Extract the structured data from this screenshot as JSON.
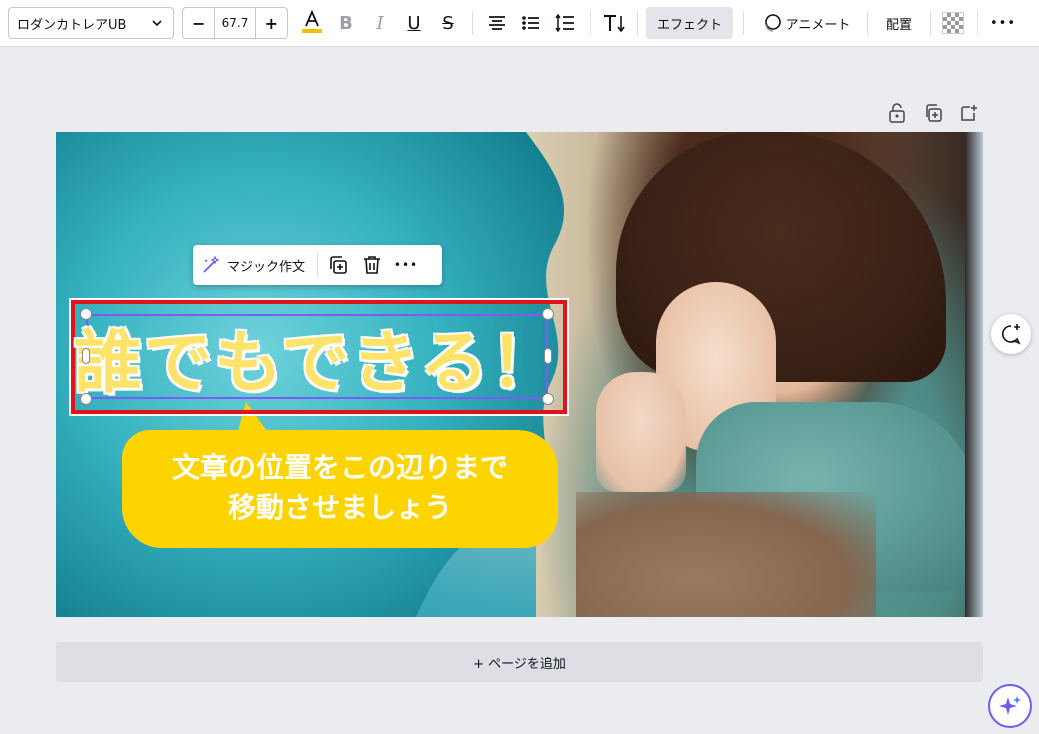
{
  "toolbar": {
    "font_name": "ロダンカトレアUB",
    "font_size": "67.7",
    "minus_label": "−",
    "plus_label": "+",
    "bold_label": "B",
    "italic_label": "I",
    "underline_label": "U",
    "strike_label": "S",
    "effect_label": "エフェクト",
    "animate_label": "アニメート",
    "arrange_label": "配置",
    "more_label": "•••",
    "text_color": "#f2c200",
    "icons": [
      "text-color-icon",
      "bold-icon",
      "italic-icon",
      "underline-icon",
      "strikethrough-icon",
      "align-center-icon",
      "list-icon",
      "line-spacing-icon",
      "text-direction-icon",
      "animate-icon",
      "transparency-icon",
      "more-icon"
    ]
  },
  "page_controls": {
    "icons": [
      "lock-icon",
      "duplicate-page-icon",
      "add-page-icon"
    ]
  },
  "context_bar": {
    "magic_write_label": "マジック作文",
    "more_label": "•••",
    "icons": [
      "magic-wand-icon",
      "duplicate-icon",
      "trash-icon",
      "more-icon"
    ]
  },
  "canvas": {
    "headline": "誰でもできる！",
    "bubble_line1": "文章の位置をこの辺りまで",
    "bubble_line2": "移動させましょう",
    "bubble_color": "#fdd400",
    "highlight_color": "#e0131a",
    "selection_color": "#7b5cf5"
  },
  "add_page": {
    "label": "+ ページを追加"
  },
  "floating": {
    "icons": [
      "comment-add-icon",
      "magic-sparkle-icon"
    ]
  }
}
